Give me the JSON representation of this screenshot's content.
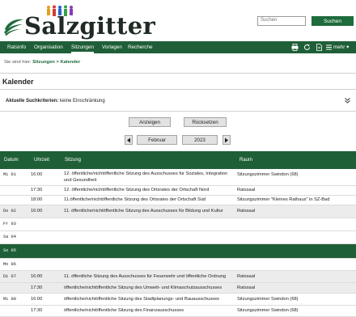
{
  "header": {
    "logo_text": "Salzgitter",
    "search_placeholder": "Suchen",
    "search_button": "Suchen"
  },
  "nav": {
    "items": [
      "Ratsinfo",
      "Organisation",
      "Sitzungen",
      "Vorlagen",
      "Recherche"
    ],
    "active": "Sitzungen",
    "more_label": "mehr"
  },
  "breadcrumb": {
    "prefix": "Sie sind hier:",
    "parent": "Sitzungen",
    "separator": ">",
    "current": "Kalender"
  },
  "page": {
    "title": "Kalender",
    "criteria_label": "Aktuelle Suchkriterien:",
    "criteria_value": "keine Einschränkung",
    "show_button": "Anzeigen",
    "reset_button": "Rücksetzen",
    "month": "Februar",
    "year": "2023"
  },
  "table": {
    "headers": [
      "Datum",
      "Uhrzeit",
      "Sitzung",
      "Raum"
    ],
    "rows": [
      {
        "day": "Mi  01",
        "time": "16:00",
        "subject": "12. öffentliche/nichtöffentliche Sitzung des Ausschusses für Soziales, Integration und Gesundheit",
        "room": "Sitzungszimmer Swindon (68)"
      },
      {
        "day": "",
        "time": "17:30",
        "subject": "12. öffentliche/nichtöffentliche Sitzung des Ortsrates der Ortschaft Nord",
        "room": "Ratssaal"
      },
      {
        "day": "",
        "time": "18:00",
        "subject": "11.öffentliche/nichtöffentliche Sitzung des Ortsrates der Ortschaft Süd",
        "room": "Sitzungszimmer \"Kleines Rathaus\" in SZ-Bad"
      },
      {
        "day": "Do  02",
        "time": "16:00",
        "subject": "11. öffentliche/nichtöffentliche Sitzung des Ausschusses für Bildung und Kultur",
        "room": "Ratssaal"
      },
      {
        "day": "Fr  03",
        "time": "",
        "subject": "",
        "room": ""
      },
      {
        "day": "Sa  04",
        "time": "",
        "subject": "",
        "room": ""
      },
      {
        "day": "So  05",
        "time": "",
        "subject": "",
        "room": ""
      },
      {
        "day": "Mo  06",
        "time": "",
        "subject": "",
        "room": ""
      },
      {
        "day": "Di  07",
        "time": "16:00",
        "subject": "11. öffentliche Sitzung des Ausschusses für Feuerwehr und öffentliche Ordnung",
        "room": "Ratssaal"
      },
      {
        "day": "",
        "time": "17:30",
        "subject": "öffentliche/nichtöffentliche Sitzung des Umwelt- und Klimaschutzausschusses",
        "room": "Ratssaal"
      },
      {
        "day": "Mi  08",
        "time": "16:00",
        "subject": "öffentliche/nichtöffentliche Sitzung des Stadtplanungs- und Bauausschusses",
        "room": "Sitzungszimmer Swindon (68)"
      },
      {
        "day": "",
        "time": "17:30",
        "subject": "öffentliche/nichtöffentliche Sitzung des Finanzausschusses",
        "room": "Sitzungszimmer Swindon (68)"
      }
    ]
  },
  "colors": {
    "brand_green": "#1f5f37",
    "row_shade": "#ececec"
  }
}
